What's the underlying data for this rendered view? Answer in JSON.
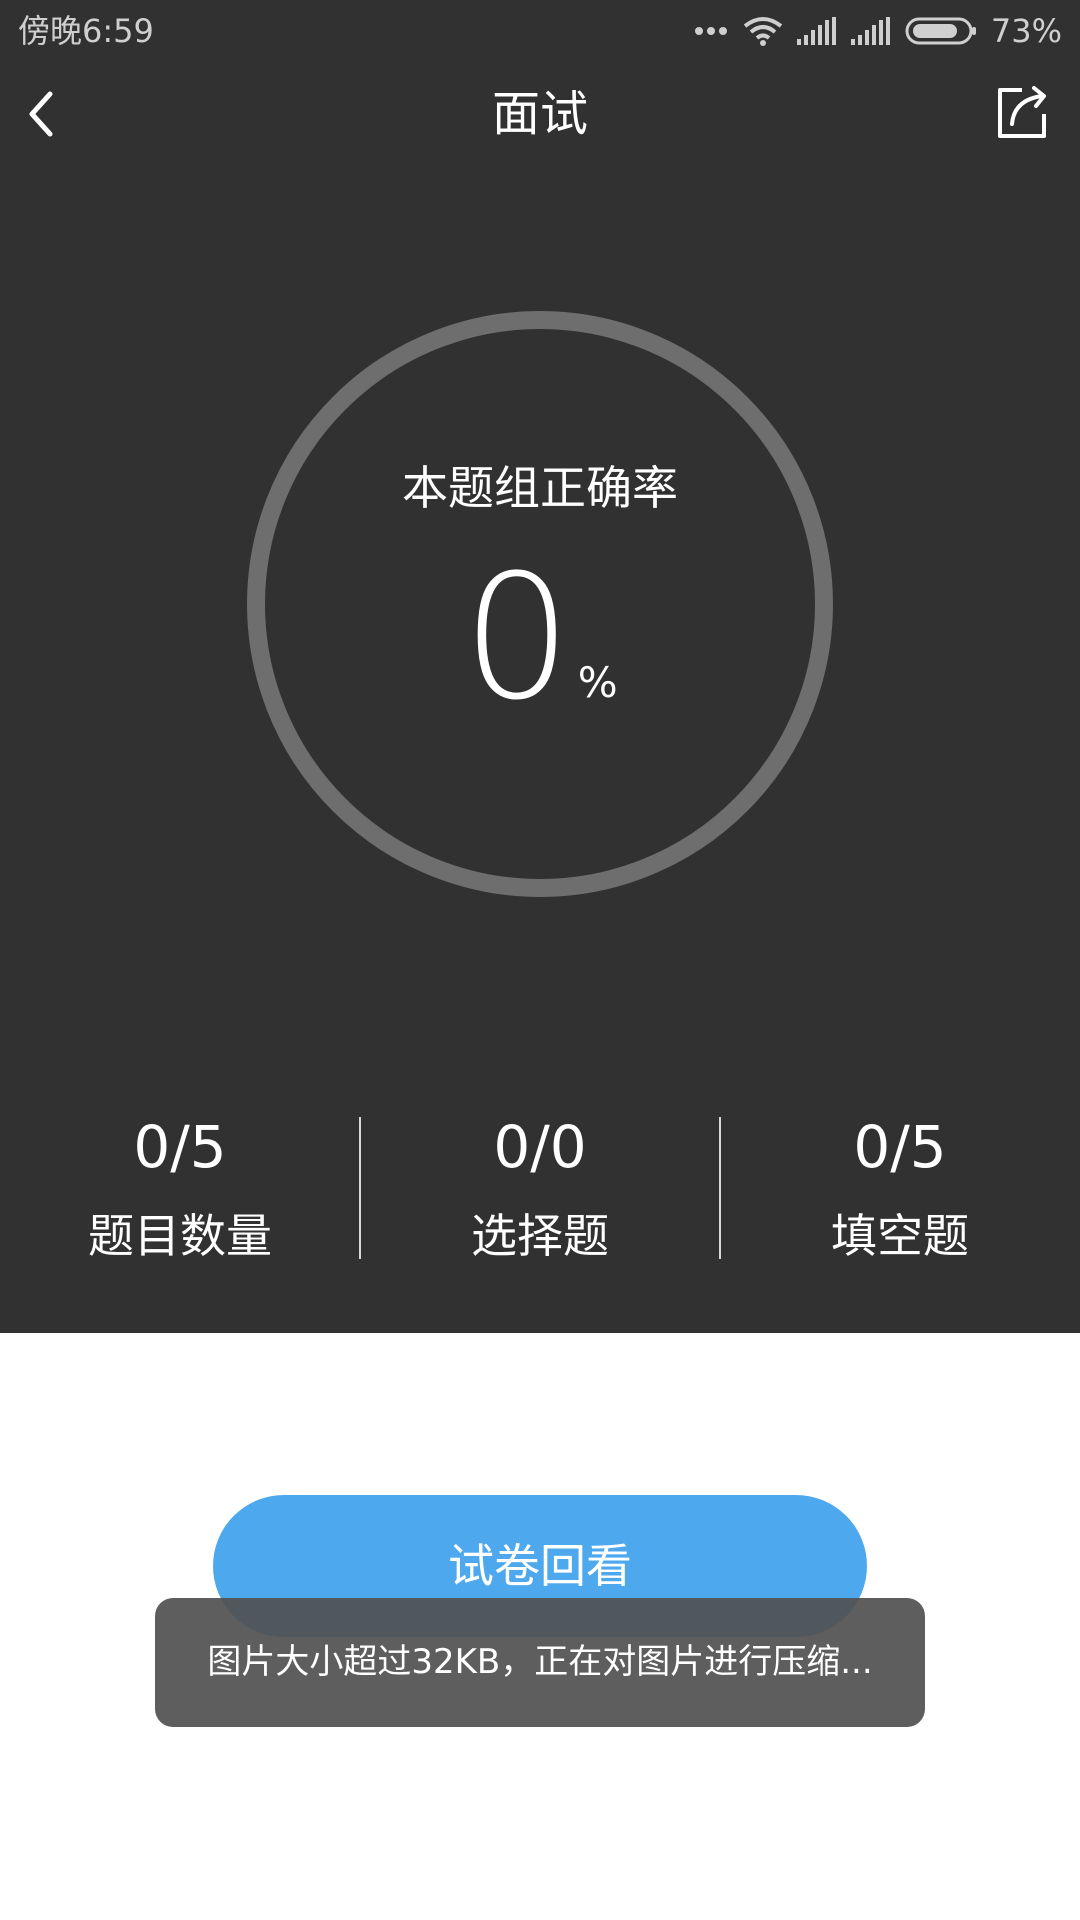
{
  "status_bar": {
    "time": "傍晚6:59",
    "battery_percent": "73%",
    "icons": [
      "more-dots-icon",
      "wifi-icon",
      "signal-icon",
      "signal-icon",
      "battery-icon"
    ]
  },
  "nav": {
    "title": "面试",
    "back_icon": "chevron-left-icon",
    "share_icon": "share-icon"
  },
  "accuracy": {
    "label": "本题组正确率",
    "value": "0",
    "unit": "%",
    "progress": 0
  },
  "stats": [
    {
      "value": "0/5",
      "label": "题目数量"
    },
    {
      "value": "0/0",
      "label": "选择题"
    },
    {
      "value": "0/5",
      "label": "填空题"
    }
  ],
  "review_button": {
    "label": "试卷回看"
  },
  "toast": {
    "message": "图片大小超过32KB，正在对图片进行压缩..."
  },
  "colors": {
    "header_bg": "#313131",
    "ring": "#6e6e6e",
    "button": "#4ea8ee",
    "toast_bg": "#505050"
  }
}
